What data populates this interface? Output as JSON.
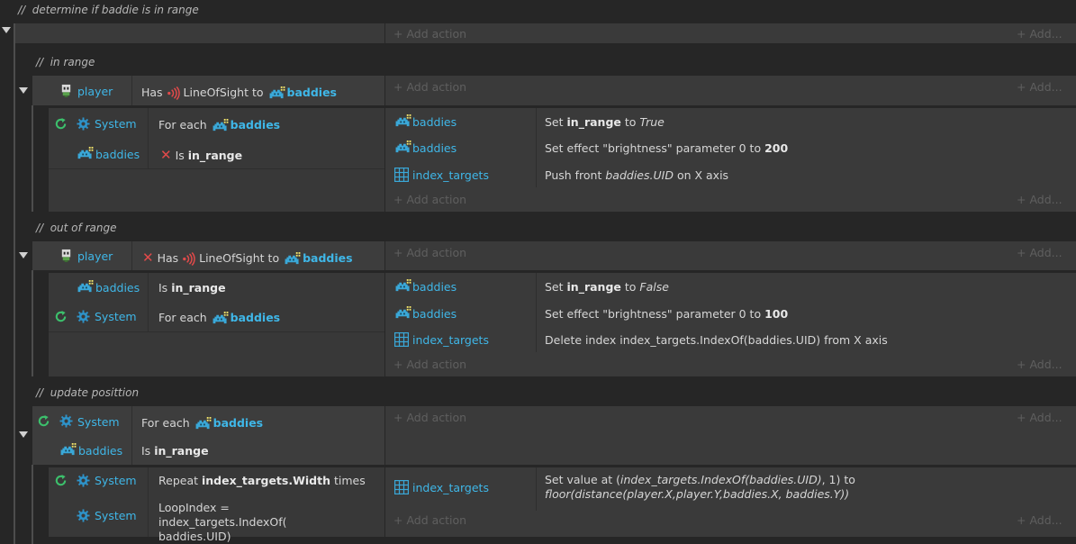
{
  "groups": [
    {
      "comment": "//  determine if baddie is in range",
      "add_action": "+ Add action",
      "add_more": "+ Add..."
    },
    {
      "comment": "//  in range",
      "event": {
        "object": "player",
        "cond_prefix": "Has",
        "cond_middle": "LineOfSight to",
        "cond_target": "baddies",
        "add_action": "+ Add action",
        "add_more": "+ Add..."
      },
      "sub": {
        "conditions": [
          {
            "object": "System",
            "text_prefix": "For each",
            "target": "baddies"
          },
          {
            "object": "baddies",
            "text_prefix": "Is",
            "bold": "in_range"
          }
        ],
        "actions": [
          {
            "object": "baddies",
            "text_prefix": "Set",
            "bold": "in_range",
            "mid": "to",
            "italic": "True"
          },
          {
            "object": "baddies",
            "text_prefix": "Set effect \"brightness\" parameter 0 to",
            "bold": "200"
          },
          {
            "object": "index_targets",
            "text_prefix": "Push front",
            "italic": "baddies.UID",
            "suffix": "on X axis"
          }
        ],
        "add_action": "+ Add action",
        "add_more": "+ Add..."
      }
    },
    {
      "comment": "//  out of range",
      "event": {
        "object": "player",
        "cond_prefix": "Has",
        "cond_middle": "LineOfSight to",
        "cond_target": "baddies",
        "add_action": "+ Add action",
        "add_more": "+ Add..."
      },
      "sub": {
        "conditions": [
          {
            "object": "baddies",
            "text_prefix": "Is",
            "bold": "in_range"
          },
          {
            "object": "System",
            "text_prefix": "For each",
            "target": "baddies"
          }
        ],
        "actions": [
          {
            "object": "baddies",
            "text_prefix": "Set",
            "bold": "in_range",
            "mid": "to",
            "italic": "False"
          },
          {
            "object": "baddies",
            "text_prefix": "Set effect \"brightness\" parameter 0 to",
            "bold": "100"
          },
          {
            "object": "index_targets",
            "text": "Delete index index_targets.IndexOf(baddies.UID) from X axis"
          }
        ],
        "add_action": "+ Add action",
        "add_more": "+ Add..."
      }
    },
    {
      "comment": "//  update posittion",
      "event": {
        "conditions": [
          {
            "object": "System",
            "text_prefix": "For each",
            "target": "baddies"
          },
          {
            "object": "baddies",
            "text_prefix": "Is",
            "bold": "in_range"
          }
        ],
        "add_action": "+ Add action",
        "add_more": "+ Add..."
      },
      "sub": {
        "conditions": [
          {
            "object": "System",
            "text_prefix": "Repeat",
            "bold": "index_targets.Width",
            "suffix": "times"
          },
          {
            "object": "System",
            "text": "LoopIndex = index_targets.IndexOf( baddies.UID)"
          }
        ],
        "actions": [
          {
            "object": "index_targets",
            "text_prefix": "Set value at (",
            "italic": "index_targets.IndexOf(baddies.UID)",
            "mid": ", 1) to",
            "italic2": "floor(distance(player.X,player.Y,baddies.X, baddies.Y))"
          }
        ],
        "add_action": "+ Add action",
        "add_more": "+ Add..."
      }
    }
  ],
  "colors": {
    "object_blue": "#3fb7e8",
    "loop_green": "#3cc06c",
    "invert_red": "#e24a4a",
    "background": "#262626",
    "row": "#3d3d3d"
  },
  "icons": {
    "player": "player-skull-icon",
    "baddies": "baddie-sprite-icon",
    "system": "gear-icon",
    "loop": "loop-icon",
    "invert": "invert-x-icon",
    "los": "line-of-sight-icon",
    "array": "array-grid-icon"
  }
}
